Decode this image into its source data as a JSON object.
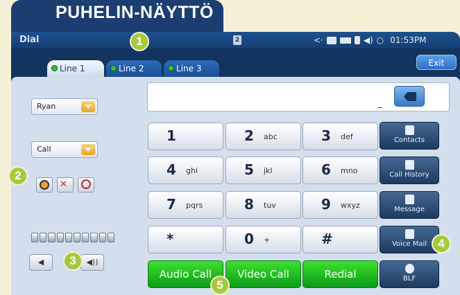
{
  "header": {
    "title": "PUHELIN-NÄYTTÖ"
  },
  "status_bar": {
    "title": "Dial",
    "page_number": "2",
    "time": "01:53PM"
  },
  "exit_label": "Exit",
  "lines": [
    {
      "label": "Line 1",
      "active": true
    },
    {
      "label": "Line 2",
      "active": false
    },
    {
      "label": "Line 3",
      "active": false
    }
  ],
  "account_select": {
    "value": "Ryan"
  },
  "mode_select": {
    "value": "Call"
  },
  "number_input": {
    "value": "",
    "cursor": "_"
  },
  "keypad": [
    {
      "digit": "1",
      "letters": ""
    },
    {
      "digit": "2",
      "letters": "abc"
    },
    {
      "digit": "3",
      "letters": "def"
    },
    {
      "digit": "4",
      "letters": "ghi"
    },
    {
      "digit": "5",
      "letters": "jkl"
    },
    {
      "digit": "6",
      "letters": "mno"
    },
    {
      "digit": "7",
      "letters": "pqrs"
    },
    {
      "digit": "8",
      "letters": "tuv"
    },
    {
      "digit": "9",
      "letters": "wxyz"
    },
    {
      "digit": "*",
      "letters": ""
    },
    {
      "digit": "0",
      "letters": "+"
    },
    {
      "digit": "#",
      "letters": ""
    }
  ],
  "call_buttons": {
    "audio": "Audio Call",
    "video": "Video Call",
    "redial": "Redial"
  },
  "side_buttons": {
    "contacts": "Contacts",
    "call_history": "Call History",
    "message": "Message",
    "voice_mail": "Voice Mail",
    "blf": "BLF"
  },
  "volume": {
    "segments": 10,
    "minus_icon": "volume-down-icon",
    "plus_icon": "volume-up-icon"
  },
  "badges": [
    "1",
    "2",
    "3",
    "4",
    "5"
  ],
  "colors": {
    "background": "#f4f1d6",
    "frame": "#13345f",
    "badge": "#a5c93b",
    "call_green": "#1cbf22",
    "accent_orange": "#f0a526"
  }
}
